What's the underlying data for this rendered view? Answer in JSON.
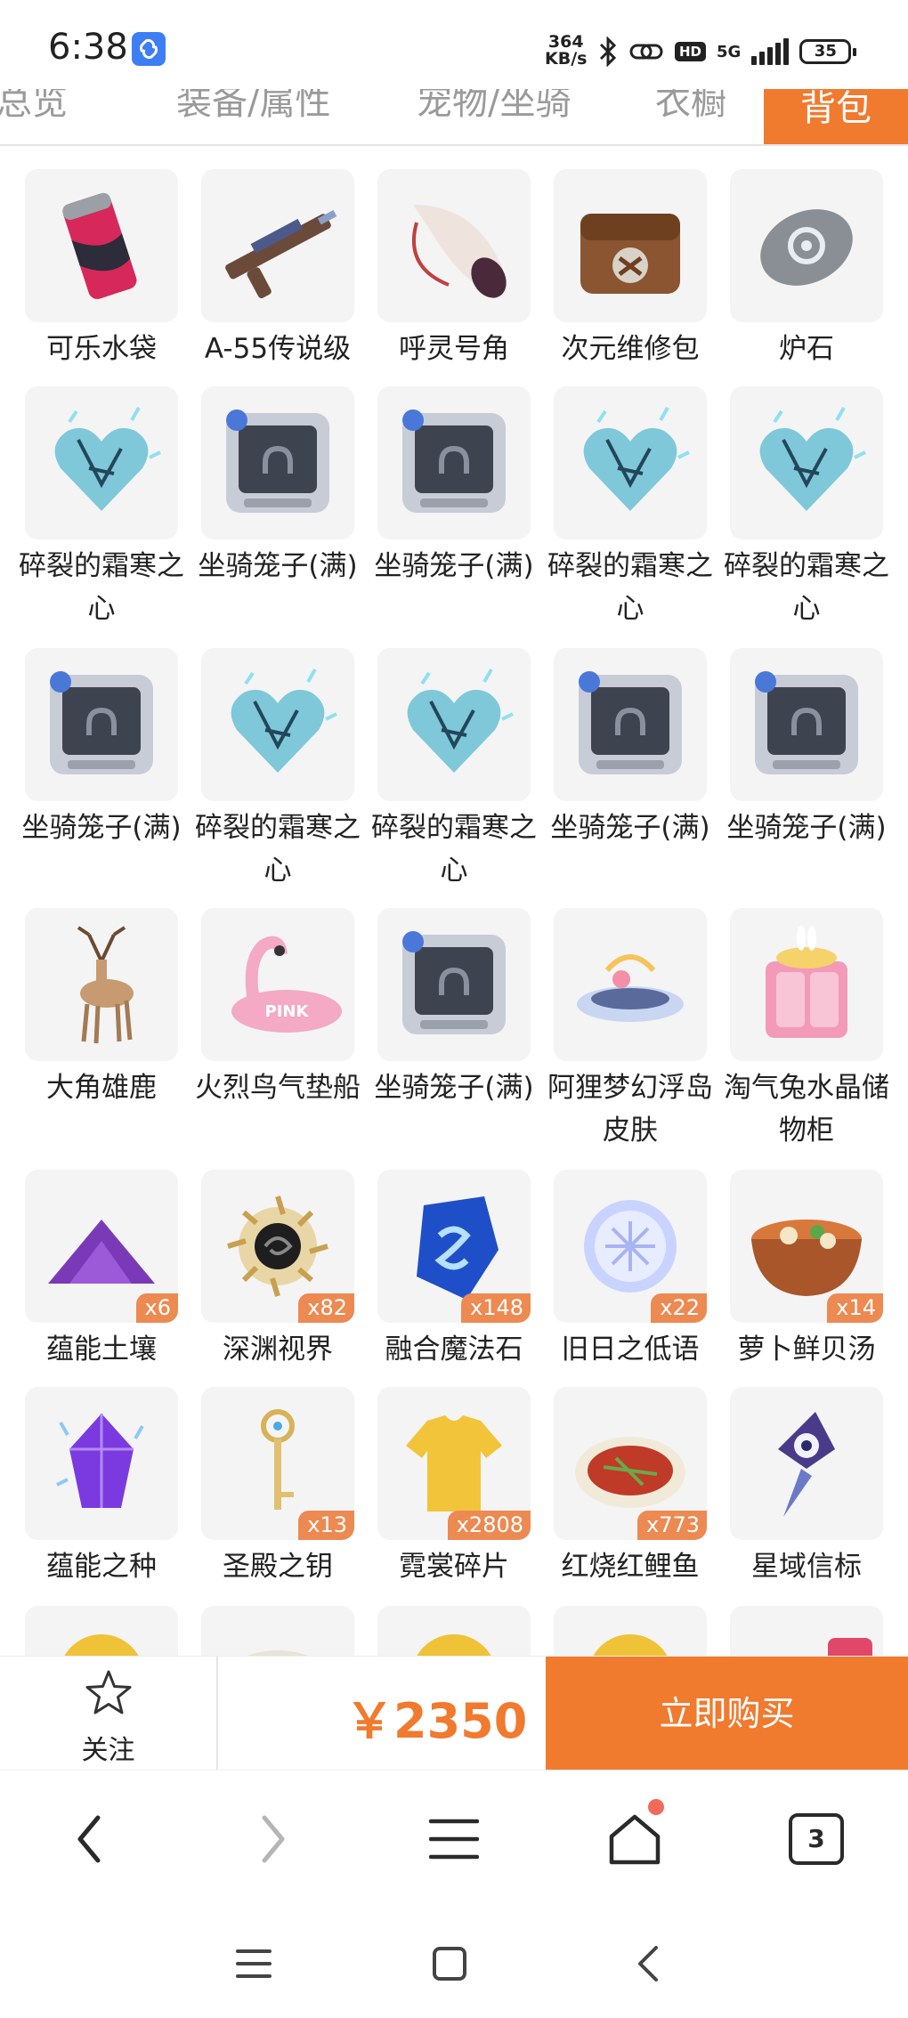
{
  "status_bar": {
    "time": "6:38",
    "speed_value": "364",
    "speed_unit": "KB/s",
    "hd_label": "HD",
    "network": "5G",
    "battery": "35"
  },
  "tabs": [
    {
      "label": "总览"
    },
    {
      "label": "装备/属性"
    },
    {
      "label": "宠物/坐骑"
    },
    {
      "label": "衣橱"
    },
    {
      "label": "背包"
    }
  ],
  "items": [
    {
      "name": "可乐水袋",
      "icon": "cola-can-icon",
      "qty": ""
    },
    {
      "name": "A-55传说级",
      "icon": "rifle-icon",
      "qty": ""
    },
    {
      "name": "呼灵号角",
      "icon": "horn-icon",
      "qty": ""
    },
    {
      "name": "次元维修包",
      "icon": "repair-bag-icon",
      "qty": ""
    },
    {
      "name": "炉石",
      "icon": "hearthstone-icon",
      "qty": ""
    },
    {
      "name": "碎裂的霜寒之心",
      "icon": "frost-heart-icon",
      "qty": ""
    },
    {
      "name": "坐骑笼子(满)",
      "icon": "mount-cage-icon",
      "qty": ""
    },
    {
      "name": "坐骑笼子(满)",
      "icon": "mount-cage-icon",
      "qty": ""
    },
    {
      "name": "碎裂的霜寒之心",
      "icon": "frost-heart-icon",
      "qty": ""
    },
    {
      "name": "碎裂的霜寒之心",
      "icon": "frost-heart-icon",
      "qty": ""
    },
    {
      "name": "坐骑笼子(满)",
      "icon": "mount-cage-icon",
      "qty": ""
    },
    {
      "name": "碎裂的霜寒之心",
      "icon": "frost-heart-icon",
      "qty": ""
    },
    {
      "name": "碎裂的霜寒之心",
      "icon": "frost-heart-icon",
      "qty": ""
    },
    {
      "name": "坐骑笼子(满)",
      "icon": "mount-cage-icon",
      "qty": ""
    },
    {
      "name": "坐骑笼子(满)",
      "icon": "mount-cage-icon",
      "qty": ""
    },
    {
      "name": "大角雄鹿",
      "icon": "stag-icon",
      "qty": ""
    },
    {
      "name": "火烈鸟气垫船",
      "icon": "flamingo-float-icon",
      "qty": ""
    },
    {
      "name": "坐骑笼子(满)",
      "icon": "mount-cage-icon",
      "qty": ""
    },
    {
      "name": "阿狸梦幻浮岛皮肤",
      "icon": "floating-island-icon",
      "qty": ""
    },
    {
      "name": "淘气兔水晶储物柜",
      "icon": "bunny-cabinet-icon",
      "qty": ""
    },
    {
      "name": "蕴能土壤",
      "icon": "soil-icon",
      "qty": "x6"
    },
    {
      "name": "深渊视界",
      "icon": "abyss-eye-icon",
      "qty": "x82"
    },
    {
      "name": "融合魔法石",
      "icon": "magic-stone-icon",
      "qty": "x148"
    },
    {
      "name": "旧日之低语",
      "icon": "whisper-orb-icon",
      "qty": "x22"
    },
    {
      "name": "萝卜鲜贝汤",
      "icon": "soup-bowl-icon",
      "qty": "x14"
    },
    {
      "name": "蕴能之种",
      "icon": "crystal-seed-icon",
      "qty": ""
    },
    {
      "name": "圣殿之钥",
      "icon": "key-icon",
      "qty": "x13"
    },
    {
      "name": "霓裳碎片",
      "icon": "shirt-icon",
      "qty": "x2808"
    },
    {
      "name": "红烧红鲤鱼",
      "icon": "fish-dish-icon",
      "qty": "x773"
    },
    {
      "name": "星域信标",
      "icon": "beacon-icon",
      "qty": ""
    }
  ],
  "buy_bar": {
    "follow_label": "关注",
    "price": "￥2350",
    "buy_label": "立即购买"
  },
  "browser_nav": {
    "tab_count": "3"
  },
  "colors": {
    "accent": "#f07a2e",
    "qty_badge": "#ec8a52",
    "card_bg": "#f4f4f5"
  }
}
